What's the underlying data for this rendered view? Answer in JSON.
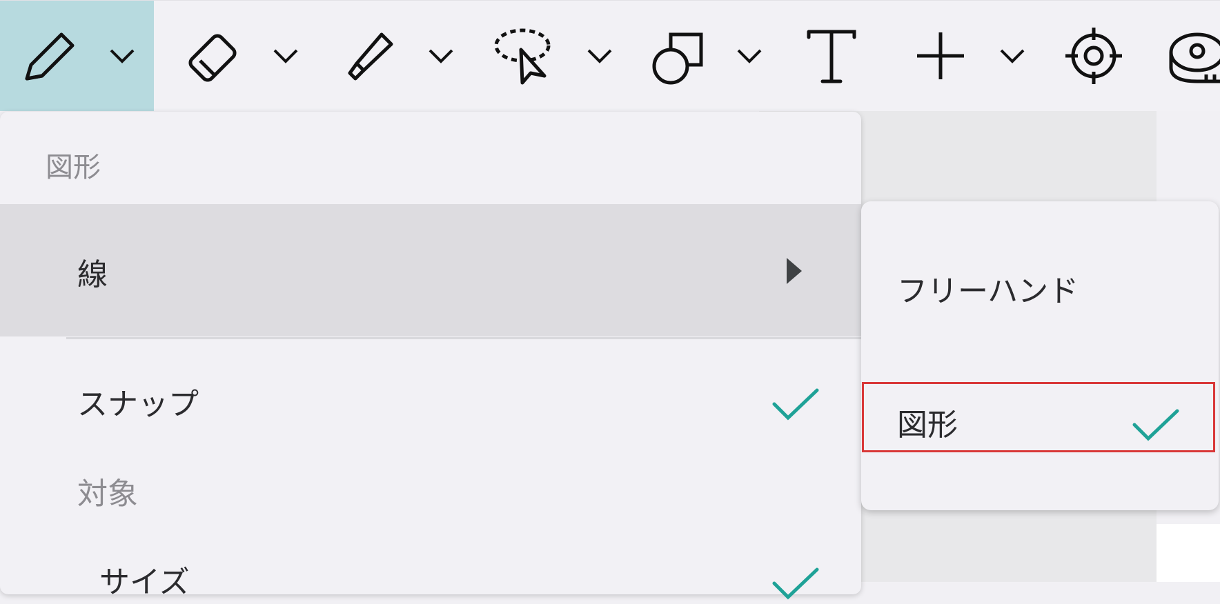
{
  "toolbar": {
    "tools": [
      {
        "name": "pencil-icon",
        "active": true
      },
      {
        "name": "eraser-icon"
      },
      {
        "name": "highlighter-icon"
      },
      {
        "name": "lasso-select-icon"
      },
      {
        "name": "shapes-icon"
      },
      {
        "name": "text-icon"
      },
      {
        "name": "add-icon"
      },
      {
        "name": "crosshair-target-icon"
      },
      {
        "name": "tape-measure-icon"
      }
    ]
  },
  "menu": {
    "header": "図形",
    "line_label": "線",
    "snap_label": "スナップ",
    "target_label": "対象",
    "size_label": "サイズ"
  },
  "submenu": {
    "freehand_label": "フリーハンド",
    "shape_label": "図形"
  },
  "colors": {
    "accent_check": "#1fa297",
    "active_tool_bg": "#b7dadf",
    "highlight_border": "#d93838"
  }
}
